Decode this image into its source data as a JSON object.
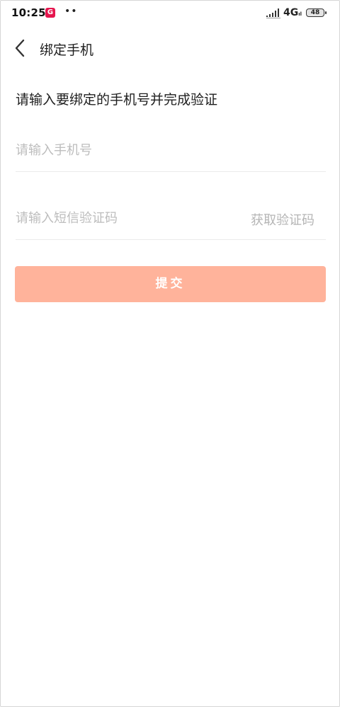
{
  "status_bar": {
    "time": "10:25",
    "app_badge": "G",
    "dots": "••",
    "network": "4G",
    "network_suffix": "ıl",
    "battery": "48",
    "icons": [
      "app-notification-icon",
      "signal-icon",
      "battery-icon"
    ]
  },
  "header": {
    "title": "绑定手机",
    "back_icon": "chevron-left-icon"
  },
  "form": {
    "instruction": "请输入要绑定的手机号并完成验证",
    "phone_placeholder": "请输入手机号",
    "phone_value": "",
    "code_placeholder": "请输入短信验证码",
    "code_value": "",
    "get_code_label": "获取验证码",
    "submit_label": "提交"
  },
  "colors": {
    "submit_bg": "#ffb39b",
    "placeholder": "#bdbdbd",
    "divider": "#ebebeb"
  }
}
